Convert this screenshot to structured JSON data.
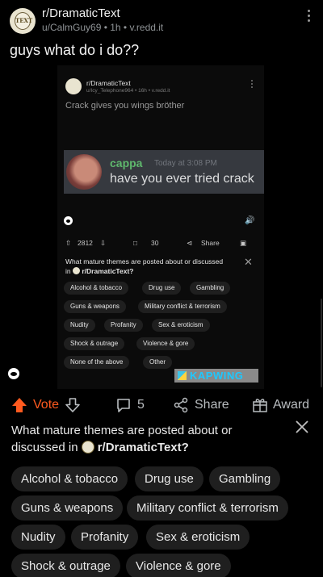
{
  "post": {
    "subreddit": "r/DramaticText",
    "meta": "u/CalmGuy69 • 1h • v.redd.it",
    "title": "guys what do i do??",
    "avatar_text": "TEXT"
  },
  "video": {
    "subreddit": "r/DramaticText",
    "meta": "u/Icy_Telephone964 • 16h • v.redd.it",
    "title": "Crack gives you wings bröther",
    "discord": {
      "username": "cappa",
      "timestamp": "Today at 3:08 PM",
      "message": "have you ever tried crack"
    },
    "upvotes": "2812",
    "comments": "30",
    "share_label": "Share",
    "question_prefix": "What mature themes are posted about or discussed in",
    "question_sub": "r/DramaticText?",
    "tags": [
      "Alcohol & tobacco",
      "Drug use",
      "Gambling",
      "Guns & weapons",
      "Military conflict & terrorism",
      "Nudity",
      "Profanity",
      "Sex & eroticism",
      "Shock & outrage",
      "Violence & gore",
      "None of the above",
      "Other"
    ],
    "kapwing": "KAPWING"
  },
  "actions": {
    "vote_label": "Vote",
    "comments": "5",
    "share_label": "Share",
    "award_label": "Award"
  },
  "question": {
    "prefix": "What mature themes are posted about or discussed in",
    "subreddit": "r/DramaticText?"
  },
  "tags": [
    "Alcohol & tobacco",
    "Drug use",
    "Gambling",
    "Guns & weapons",
    "Military conflict & terrorism",
    "Nudity",
    "Profanity",
    "Sex & eroticism",
    "Shock & outrage",
    "Violence & gore"
  ],
  "colors": {
    "accent": "#ff5a1f",
    "background": "#000000",
    "chip": "#1f1f1f",
    "discord_name": "#5fb86d"
  }
}
